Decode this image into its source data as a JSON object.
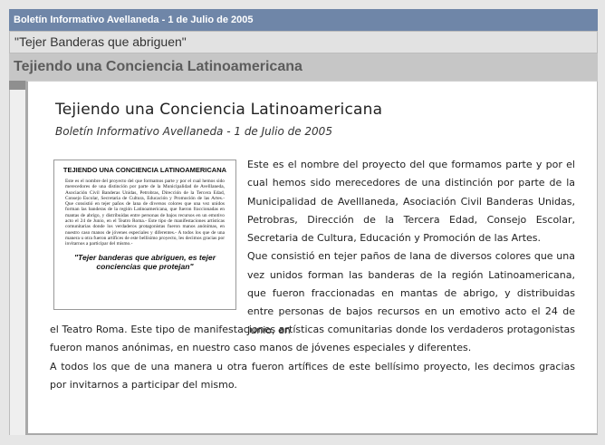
{
  "header": {
    "bulletin": "Boletín Informativo Avellaneda - 1 de Julio de 2005",
    "subtitle": "\"Tejer Banderas que abriguen\"",
    "section_title": "Tejiendo una Conciencia Latinoamericana"
  },
  "article": {
    "title": "Tejiendo una Conciencia Latinoamericana",
    "subtitle": "Boletín Informativo Avellaneda - 1 de Julio de 2005",
    "paragraph1": "Este es el nombre del proyecto del que formamos parte y por el cual hemos sido merecedores de una distinción por parte de la Municipalidad de Avelllaneda, Asociación Civil Banderas Unidas, Petrobras, Dirección de la Tercera Edad, Consejo Escolar, Secretaria de Cultura, Educación y Promoción de las Artes.",
    "paragraph2a": "Que consistió en tejer paños de lana de diversos colores que una vez unidos forman las banderas de la región Latinoamericana, que fueron fraccionadas en mantas de abrigo, y distribuidas entre personas de bajos recursos en un emotivo acto el 24 de Junio, en",
    "paragraph2b": "el Teatro Roma. Este tipo de manifestaciones artísticas comunitarias donde los verdaderos protagonistas fueron manos anónimas, en nuestro caso manos de jóvenes especiales y diferentes.",
    "paragraph3": "A todos los que de una manera u otra fueron artífices de este bellísimo proyecto, les decimos gracias por invitarnos a participar del mismo."
  },
  "clipping": {
    "title": "TEJIENDO UNA CONCIENCIA LATINOAMERICANA",
    "body": "Este es el nombre del proyecto del que formamos parte y por el cual hemos sido merecedores de una distinción por parte de la Municipalidad de Avelllaneda, Asociación Civil Banderas Unidas, Petrobras, Dirección de la Tercera Edad, Consejo Escolar, Secretaria de Cultura, Educación y Promoción de las Artes.- Que consistió en tejer paños de lana de diversos colores que una vez unidos forman las banderas de la región Latinoamericana, que fueron fraccionadas en mantas de abrigo, y distribuidas entre personas de bajos recursos en un emotivo acto el 24 de Junio, en el Teatro Roma.- Este tipo de manifestaciones artísticas comunitarias donde los verdaderos protagonistas fueron manos anónimas, en nuestro caso manos de jóvenes especiales y diferentes.- A todos los que de una manera u otra fueron artífices de este bellísimo proyecto, les decimos gracias por invitarnos a participar del mismo.-",
    "quote": "\"Tejer banderas que abriguen, es tejer conciencias que protejan\""
  },
  "colors": {
    "top_bar": "#6f86a8",
    "section_bar": "#c6c6c6"
  }
}
